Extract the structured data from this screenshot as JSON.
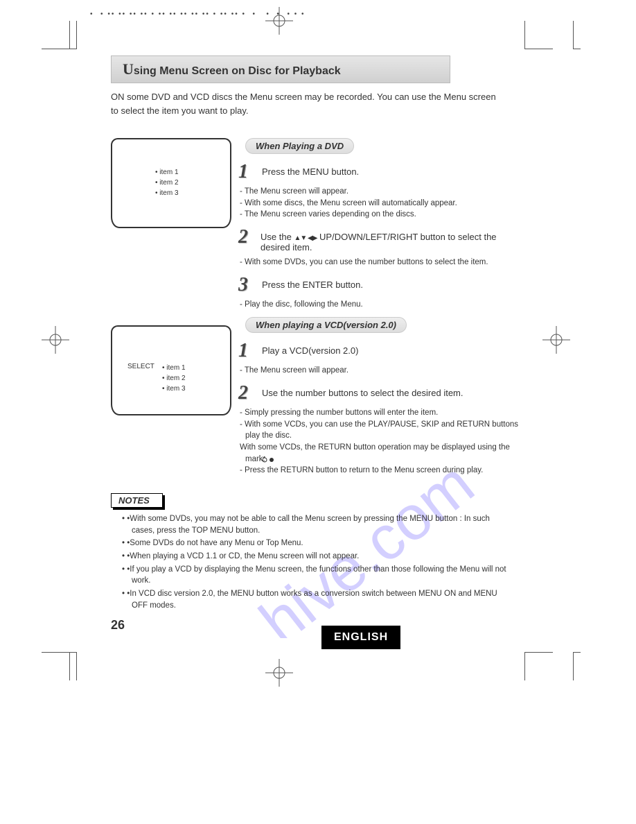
{
  "title_prefix": "U",
  "title_rest": "sing Menu Screen on Disc for Playback",
  "intro": "ON some DVD and VCD discs the Menu screen may be recorded. You can use the Menu screen to select the item you want to play.",
  "tv1": {
    "items": [
      "• item 1",
      "• item 2",
      "• item 3"
    ]
  },
  "tv2": {
    "select": "SELECT",
    "items": [
      "• item 1",
      "• item 2",
      "• item 3"
    ]
  },
  "section_dvd": {
    "heading": "When Playing a DVD",
    "step1": "Press the MENU button.",
    "step1_sub": [
      "- The Menu screen will appear.",
      "- With some discs, the Menu screen will automatically appear.",
      "- The Menu screen varies depending on the discs."
    ],
    "step2_a": "Use the ",
    "step2_b": " UP/DOWN/LEFT/RIGHT button to select the desired item.",
    "step2_sub": [
      "- With some DVDs, you can use the number buttons to select the item."
    ],
    "step3": "Press the ENTER button.",
    "step3_sub": [
      "- Play the disc, following the Menu."
    ]
  },
  "section_vcd": {
    "heading": "When playing a VCD(version 2.0)",
    "step1": "Play a VCD(version 2.0)",
    "step1_sub": [
      "- The Menu screen will appear."
    ],
    "step2": "Use the number buttons to select the desired item.",
    "step2_sub": [
      "- Simply pressing the number buttons will enter the item.",
      "- With some VCDs, you can use the PLAY/PAUSE, SKIP and RETURN buttons play the disc.",
      "  With some VCDs, the RETURN button operation may be displayed using the      mark.",
      "- Press the RETURN button to return to the Menu screen during play."
    ]
  },
  "notes_label": "NOTES",
  "notes": [
    "• •With some DVDs, you may not be able to call the Menu screen by pressing the MENU button : In such cases, press the TOP MENU button.",
    "• •Some DVDs do not have any Menu or Top Menu.",
    "• •When playing a VCD 1.1 or CD, the Menu screen will not appear.",
    "• •If you play a VCD by displaying the Menu screen, the functions other than those following the Menu will not work.",
    "• •In VCD disc version 2.0, the MENU button works as a conversion switch between MENU ON and MENU OFF modes."
  ],
  "page_number": "26",
  "english_badge": "ENGLISH",
  "watermark_text": "hive.com",
  "arrows": "▲▼ ◀▶"
}
